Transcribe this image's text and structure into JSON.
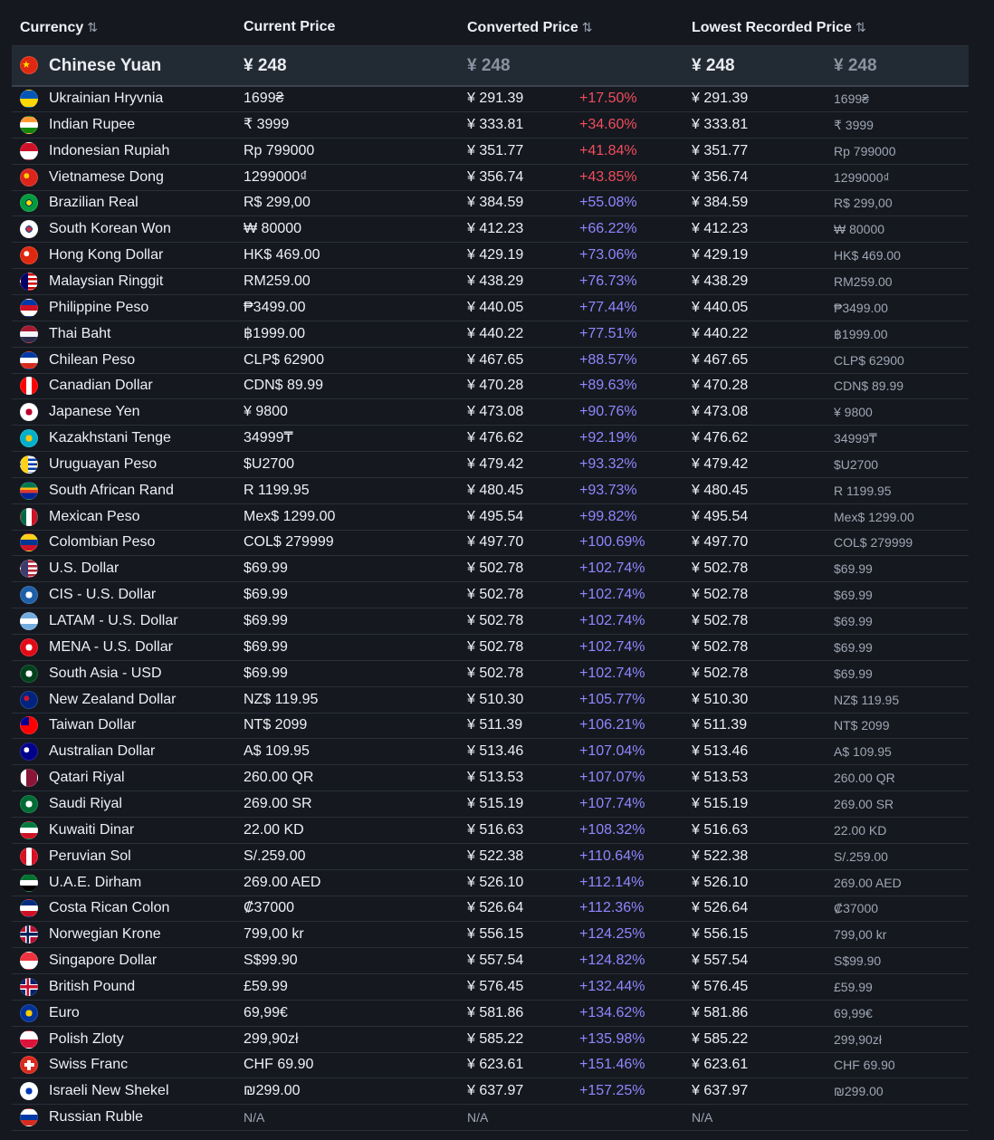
{
  "header": {
    "currency": "Currency",
    "current_price": "Current Price",
    "converted_price": "Converted Price",
    "lowest_recorded_price": "Lowest Recorded Price",
    "sort_icon": "sort-arrows-icon"
  },
  "featured": {
    "name": "Chinese Yuan",
    "price": "¥ 248",
    "converted": "¥ 248",
    "lowest": "¥ 248",
    "lowest_raw": "¥ 248",
    "flag_colors": [
      "#de2910",
      "#ffde00"
    ]
  },
  "rows": [
    {
      "name": "Ukrainian Hryvnia",
      "price": "1699₴",
      "converted": "¥ 291.39",
      "pct": "+17.50%",
      "lowest": "¥ 291.39",
      "lowest_raw": "1699₴",
      "flag": [
        "#0057b7",
        "#ffd700"
      ],
      "style": "h"
    },
    {
      "name": "Indian Rupee",
      "price": "₹ 3999",
      "converted": "¥ 333.81",
      "pct": "+34.60%",
      "lowest": "¥ 333.81",
      "lowest_raw": "₹ 3999",
      "flag": [
        "#ff9933",
        "#ffffff",
        "#138808"
      ],
      "style": "h"
    },
    {
      "name": "Indonesian Rupiah",
      "price": "Rp 799000",
      "converted": "¥ 351.77",
      "pct": "+41.84%",
      "lowest": "¥ 351.77",
      "lowest_raw": "Rp 799000",
      "flag": [
        "#ce1126",
        "#ffffff"
      ],
      "style": "h"
    },
    {
      "name": "Vietnamese Dong",
      "price": "1299000₫",
      "converted": "¥ 356.74",
      "pct": "+43.85%",
      "lowest": "¥ 356.74",
      "lowest_raw": "1299000₫",
      "flag": [
        "#da251d",
        "#ffcd00"
      ],
      "style": "star"
    },
    {
      "name": "Brazilian Real",
      "price": "R$ 299,00",
      "converted": "¥ 384.59",
      "pct": "+55.08%",
      "lowest": "¥ 384.59",
      "lowest_raw": "R$ 299,00",
      "flag": [
        "#009c3b",
        "#ffdf00",
        "#002776"
      ],
      "style": "center"
    },
    {
      "name": "South Korean Won",
      "price": "₩ 80000",
      "converted": "¥ 412.23",
      "pct": "+66.22%",
      "lowest": "¥ 412.23",
      "lowest_raw": "₩ 80000",
      "flag": [
        "#ffffff",
        "#cd2e3a",
        "#0047a0"
      ],
      "style": "center"
    },
    {
      "name": "Hong Kong Dollar",
      "price": "HK$ 469.00",
      "converted": "¥ 429.19",
      "pct": "+73.06%",
      "lowest": "¥ 429.19",
      "lowest_raw": "HK$ 469.00",
      "flag": [
        "#de2910",
        "#ffffff"
      ],
      "style": "star"
    },
    {
      "name": "Malaysian Ringgit",
      "price": "RM259.00",
      "converted": "¥ 438.29",
      "pct": "+76.73%",
      "lowest": "¥ 438.29",
      "lowest_raw": "RM259.00",
      "flag": [
        "#cc0001",
        "#ffffff",
        "#010066"
      ],
      "style": "stripes"
    },
    {
      "name": "Philippine Peso",
      "price": "₱3499.00",
      "converted": "¥ 440.05",
      "pct": "+77.44%",
      "lowest": "¥ 440.05",
      "lowest_raw": "₱3499.00",
      "flag": [
        "#0038a8",
        "#ce1126",
        "#ffffff"
      ],
      "style": "h"
    },
    {
      "name": "Thai Baht",
      "price": "฿1999.00",
      "converted": "¥ 440.22",
      "pct": "+77.51%",
      "lowest": "¥ 440.22",
      "lowest_raw": "฿1999.00",
      "flag": [
        "#a51931",
        "#f4f5f8",
        "#2d2a4a"
      ],
      "style": "h"
    },
    {
      "name": "Chilean Peso",
      "price": "CLP$ 62900",
      "converted": "¥ 467.65",
      "pct": "+88.57%",
      "lowest": "¥ 467.65",
      "lowest_raw": "CLP$ 62900",
      "flag": [
        "#0039a6",
        "#ffffff",
        "#d52b1e"
      ],
      "style": "h"
    },
    {
      "name": "Canadian Dollar",
      "price": "CDN$ 89.99",
      "converted": "¥ 470.28",
      "pct": "+89.63%",
      "lowest": "¥ 470.28",
      "lowest_raw": "CDN$ 89.99",
      "flag": [
        "#ff0000",
        "#ffffff",
        "#ff0000"
      ],
      "style": "v"
    },
    {
      "name": "Japanese Yen",
      "price": "¥ 9800",
      "converted": "¥ 473.08",
      "pct": "+90.76%",
      "lowest": "¥ 473.08",
      "lowest_raw": "¥ 9800",
      "flag": [
        "#ffffff",
        "#bc002d"
      ],
      "style": "center"
    },
    {
      "name": "Kazakhstani Tenge",
      "price": "34999₸",
      "converted": "¥ 476.62",
      "pct": "+92.19%",
      "lowest": "¥ 476.62",
      "lowest_raw": "34999₸",
      "flag": [
        "#00afca",
        "#fec50c"
      ],
      "style": "center"
    },
    {
      "name": "Uruguayan Peso",
      "price": "$U2700",
      "converted": "¥ 479.42",
      "pct": "+93.32%",
      "lowest": "¥ 479.42",
      "lowest_raw": "$U2700",
      "flag": [
        "#ffffff",
        "#0038a8",
        "#fcd116"
      ],
      "style": "stripes"
    },
    {
      "name": "South African Rand",
      "price": "R 1199.95",
      "converted": "¥ 480.45",
      "pct": "+93.73%",
      "lowest": "¥ 480.45",
      "lowest_raw": "R 1199.95",
      "flag": [
        "#007a4d",
        "#ffb612",
        "#de3831",
        "#002395"
      ],
      "style": "h"
    },
    {
      "name": "Mexican Peso",
      "price": "Mex$ 1299.00",
      "converted": "¥ 495.54",
      "pct": "+99.82%",
      "lowest": "¥ 495.54",
      "lowest_raw": "Mex$ 1299.00",
      "flag": [
        "#006847",
        "#ffffff",
        "#ce1126"
      ],
      "style": "v"
    },
    {
      "name": "Colombian Peso",
      "price": "COL$ 279999",
      "converted": "¥ 497.70",
      "pct": "+100.69%",
      "lowest": "¥ 497.70",
      "lowest_raw": "COL$ 279999",
      "flag": [
        "#fcd116",
        "#003893",
        "#ce1126"
      ],
      "style": "h"
    },
    {
      "name": "U.S. Dollar",
      "price": "$69.99",
      "converted": "¥ 502.78",
      "pct": "+102.74%",
      "lowest": "¥ 502.78",
      "lowest_raw": "$69.99",
      "flag": [
        "#b22234",
        "#ffffff",
        "#3c3b6e"
      ],
      "style": "stripes"
    },
    {
      "name": "CIS - U.S. Dollar",
      "price": "$69.99",
      "converted": "¥ 502.78",
      "pct": "+102.74%",
      "lowest": "¥ 502.78",
      "lowest_raw": "$69.99",
      "flag": [
        "#1f5fa8",
        "#ffffff"
      ],
      "style": "center"
    },
    {
      "name": "LATAM - U.S. Dollar",
      "price": "$69.99",
      "converted": "¥ 502.78",
      "pct": "+102.74%",
      "lowest": "¥ 502.78",
      "lowest_raw": "$69.99",
      "flag": [
        "#74acdf",
        "#ffffff",
        "#74acdf"
      ],
      "style": "h"
    },
    {
      "name": "MENA - U.S. Dollar",
      "price": "$69.99",
      "converted": "¥ 502.78",
      "pct": "+102.74%",
      "lowest": "¥ 502.78",
      "lowest_raw": "$69.99",
      "flag": [
        "#e30a17",
        "#ffffff"
      ],
      "style": "center"
    },
    {
      "name": "South Asia - USD",
      "price": "$69.99",
      "converted": "¥ 502.78",
      "pct": "+102.74%",
      "lowest": "¥ 502.78",
      "lowest_raw": "$69.99",
      "flag": [
        "#01411c",
        "#ffffff"
      ],
      "style": "center"
    },
    {
      "name": "New Zealand Dollar",
      "price": "NZ$ 119.95",
      "converted": "¥ 510.30",
      "pct": "+105.77%",
      "lowest": "¥ 510.30",
      "lowest_raw": "NZ$ 119.95",
      "flag": [
        "#00247d",
        "#cc142b"
      ],
      "style": "star"
    },
    {
      "name": "Taiwan Dollar",
      "price": "NT$ 2099",
      "converted": "¥ 511.39",
      "pct": "+106.21%",
      "lowest": "¥ 511.39",
      "lowest_raw": "NT$ 2099",
      "flag": [
        "#fe0000",
        "#000095"
      ],
      "style": "corner"
    },
    {
      "name": "Australian Dollar",
      "price": "A$ 109.95",
      "converted": "¥ 513.46",
      "pct": "+107.04%",
      "lowest": "¥ 513.46",
      "lowest_raw": "A$ 109.95",
      "flag": [
        "#00008b",
        "#ffffff"
      ],
      "style": "star"
    },
    {
      "name": "Qatari Riyal",
      "price": "260.00 QR",
      "converted": "¥ 513.53",
      "pct": "+107.07%",
      "lowest": "¥ 513.53",
      "lowest_raw": "260.00 QR",
      "flag": [
        "#ffffff",
        "#8a1538",
        "#8a1538"
      ],
      "style": "v"
    },
    {
      "name": "Saudi Riyal",
      "price": "269.00 SR",
      "converted": "¥ 515.19",
      "pct": "+107.74%",
      "lowest": "¥ 515.19",
      "lowest_raw": "269.00 SR",
      "flag": [
        "#006c35",
        "#ffffff"
      ],
      "style": "center"
    },
    {
      "name": "Kuwaiti Dinar",
      "price": "22.00 KD",
      "converted": "¥ 516.63",
      "pct": "+108.32%",
      "lowest": "¥ 516.63",
      "lowest_raw": "22.00 KD",
      "flag": [
        "#007a3d",
        "#ffffff",
        "#ce1126"
      ],
      "style": "h"
    },
    {
      "name": "Peruvian Sol",
      "price": "S/.259.00",
      "converted": "¥ 522.38",
      "pct": "+110.64%",
      "lowest": "¥ 522.38",
      "lowest_raw": "S/.259.00",
      "flag": [
        "#d91023",
        "#ffffff",
        "#d91023"
      ],
      "style": "v"
    },
    {
      "name": "U.A.E. Dirham",
      "price": "269.00 AED",
      "converted": "¥ 526.10",
      "pct": "+112.14%",
      "lowest": "¥ 526.10",
      "lowest_raw": "269.00 AED",
      "flag": [
        "#00732f",
        "#ffffff",
        "#000000"
      ],
      "style": "h"
    },
    {
      "name": "Costa Rican Colon",
      "price": "₡37000",
      "converted": "¥ 526.64",
      "pct": "+112.36%",
      "lowest": "¥ 526.64",
      "lowest_raw": "₡37000",
      "flag": [
        "#002b7f",
        "#ffffff",
        "#ce1126"
      ],
      "style": "h"
    },
    {
      "name": "Norwegian Krone",
      "price": "799,00 kr",
      "converted": "¥ 556.15",
      "pct": "+124.25%",
      "lowest": "¥ 556.15",
      "lowest_raw": "799,00 kr",
      "flag": [
        "#ba0c2f",
        "#ffffff",
        "#00205b"
      ],
      "style": "cross"
    },
    {
      "name": "Singapore Dollar",
      "price": "S$99.90",
      "converted": "¥ 557.54",
      "pct": "+124.82%",
      "lowest": "¥ 557.54",
      "lowest_raw": "S$99.90",
      "flag": [
        "#ef3340",
        "#ffffff"
      ],
      "style": "h"
    },
    {
      "name": "British Pound",
      "price": "£59.99",
      "converted": "¥ 576.45",
      "pct": "+132.44%",
      "lowest": "¥ 576.45",
      "lowest_raw": "£59.99",
      "flag": [
        "#012169",
        "#ffffff",
        "#c8102e"
      ],
      "style": "cross"
    },
    {
      "name": "Euro",
      "price": "69,99€",
      "converted": "¥ 581.86",
      "pct": "+134.62%",
      "lowest": "¥ 581.86",
      "lowest_raw": "69,99€",
      "flag": [
        "#003399",
        "#ffcc00"
      ],
      "style": "center"
    },
    {
      "name": "Polish Zloty",
      "price": "299,90zł",
      "converted": "¥ 585.22",
      "pct": "+135.98%",
      "lowest": "¥ 585.22",
      "lowest_raw": "299,90zł",
      "flag": [
        "#ffffff",
        "#dc143c"
      ],
      "style": "h"
    },
    {
      "name": "Swiss Franc",
      "price": "CHF 69.90",
      "converted": "¥ 623.61",
      "pct": "+151.46%",
      "lowest": "¥ 623.61",
      "lowest_raw": "CHF 69.90",
      "flag": [
        "#da291c",
        "#ffffff"
      ],
      "style": "plus"
    },
    {
      "name": "Israeli New Shekel",
      "price": "₪299.00",
      "converted": "¥ 637.97",
      "pct": "+157.25%",
      "lowest": "¥ 637.97",
      "lowest_raw": "₪299.00",
      "flag": [
        "#ffffff",
        "#0038b8"
      ],
      "style": "center"
    },
    {
      "name": "Russian Ruble",
      "price": "N/A",
      "converted": "N/A",
      "pct": "",
      "lowest": "N/A",
      "lowest_raw": "",
      "flag": [
        "#ffffff",
        "#0039a6",
        "#d52b1e"
      ],
      "style": "h"
    }
  ],
  "colors": {
    "pct_red": "#f24d5e",
    "pct_blue": "#8f87ff",
    "background": "#15181f",
    "featured_bg": "#222a33"
  }
}
